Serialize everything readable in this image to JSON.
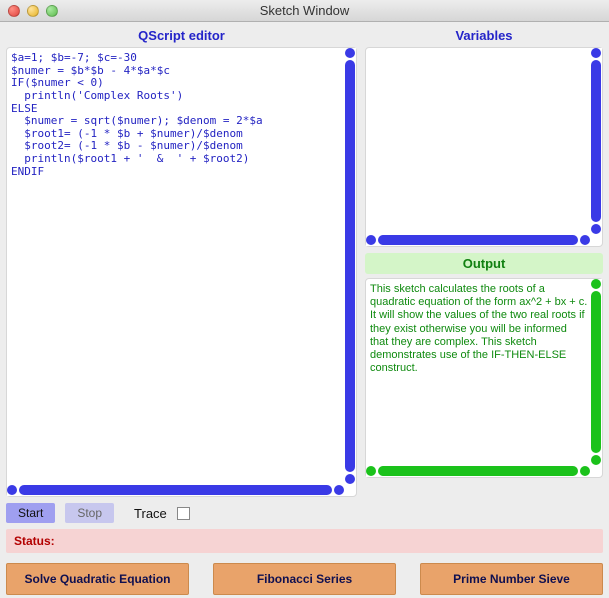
{
  "window": {
    "title": "Sketch Window"
  },
  "editor": {
    "title": "QScript editor",
    "code": "$a=1; $b=-7; $c=-30\n$numer = $b*$b - 4*$a*$c\nIF($numer < 0)\n  println('Complex Roots')\nELSE\n  $numer = sqrt($numer); $denom = 2*$a\n  $root1= (-1 * $b + $numer)/$denom\n  $root2= (-1 * $b - $numer)/$denom\n  println($root1 + '  &  ' + $root2)\nENDIF"
  },
  "variables": {
    "title": "Variables",
    "content": ""
  },
  "output": {
    "title": "Output",
    "text": "This sketch calculates the roots of a quadratic equation of the form ax^2 + bx + c. It will show the values of the two real roots if they exist otherwise you will  be informed that they are complex. This sketch demonstrates use of the IF-THEN-ELSE construct."
  },
  "controls": {
    "start": "Start",
    "stop": "Stop",
    "trace": "Trace"
  },
  "status": {
    "label": "Status:",
    "message": ""
  },
  "buttons": {
    "quadratic": "Solve Quadratic Equation",
    "fibonacci": "Fibonacci Series",
    "sieve": "Prime Number Sieve"
  }
}
